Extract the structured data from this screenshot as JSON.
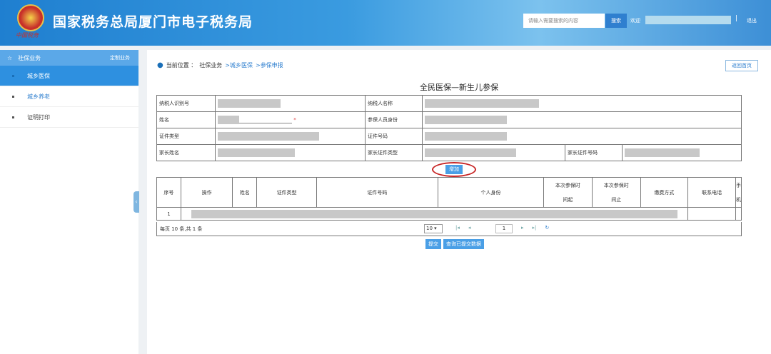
{
  "header": {
    "title": "国家税务总局厦门市电子税务局",
    "logo_text": "中国税务",
    "search_placeholder": "请输入需要搜索的内容",
    "search_label": "搜索",
    "welcome": "欢迎",
    "logout": "退出",
    "separator": "|"
  },
  "sidebar": {
    "section": "社保业务",
    "custom": "定制业务",
    "items": [
      {
        "label": "城乡医保"
      },
      {
        "label": "城乡养老"
      },
      {
        "label": "证明打印"
      }
    ],
    "collapse": "‹"
  },
  "breadcrumb": {
    "label": "当前位置 ：",
    "root": "社保业务",
    "l1": ">城乡医保",
    "l2": ">参保申报"
  },
  "home_button": "返回首页",
  "form": {
    "title": "全民医保—新生儿参保",
    "fields": {
      "taxpayer_id": "纳税人识别号",
      "taxpayer_name": "纳税人名称",
      "name": "姓名",
      "required": "*",
      "insured_identity": "参保人员身份",
      "cert_type": "证件类型",
      "cert_no": "证件号码",
      "parent_name": "家长姓名",
      "parent_cert_type": "家长证件类型",
      "parent_cert_no": "家长证件号码"
    }
  },
  "add_button": "增加",
  "grid": {
    "columns": [
      "序号",
      "操作",
      "姓名",
      "证件类型",
      "证件号码",
      "个人身份",
      "本次参保时间起",
      "本次参保时间止",
      "缴费方式",
      "联系电话",
      "手机"
    ],
    "rows": [
      {
        "index": "1"
      }
    ]
  },
  "pager": {
    "info": "每页 10 条,共 1 条",
    "page_size": "10",
    "page": "1"
  },
  "actions": {
    "submit": "提交",
    "query": "查询已提交数据"
  }
}
